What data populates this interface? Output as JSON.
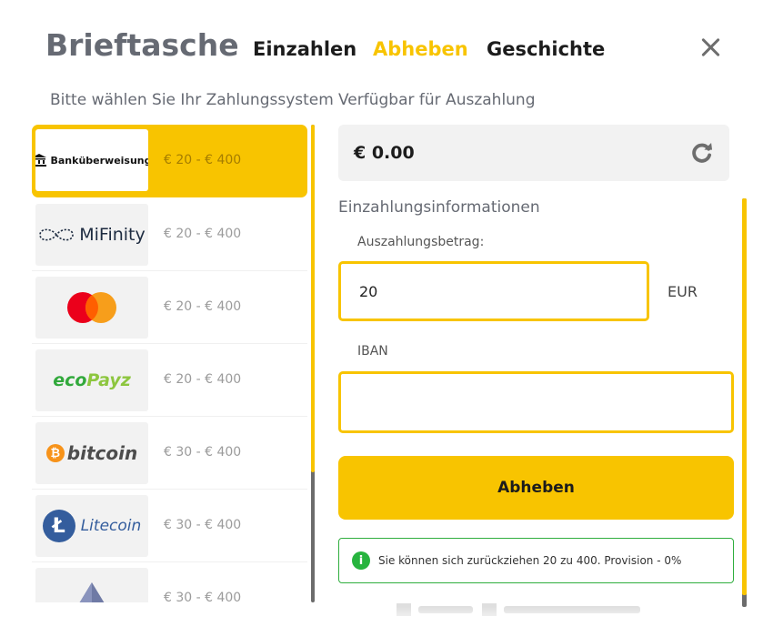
{
  "header": {
    "title": "Brieftasche",
    "tabs": [
      {
        "label": "Einzahlen",
        "active": false
      },
      {
        "label": "Abheben",
        "active": true
      },
      {
        "label": "Geschichte",
        "active": false
      }
    ]
  },
  "left": {
    "heading": "Bitte wählen Sie Ihr Zahlungssystem",
    "methods": [
      {
        "name": "Banküberweisung",
        "logo_text": "Banküberweisung",
        "range": "€ 20 - € 400",
        "selected": true
      },
      {
        "name": "MiFinity",
        "logo_text": "MiFinity",
        "range": "€ 20 - € 400"
      },
      {
        "name": "Mastercard",
        "logo_text": "",
        "range": "€ 20 - € 400"
      },
      {
        "name": "ecoPayz",
        "logo_text": "ecoPayz",
        "range": "€ 20 - € 400"
      },
      {
        "name": "bitcoin",
        "logo_text": "bitcoin",
        "range": "€ 30 - € 400"
      },
      {
        "name": "Litecoin",
        "logo_text": "Litecoin",
        "range": "€ 30 - € 400"
      },
      {
        "name": "Ethereum",
        "logo_text": "",
        "range": "€ 30 - € 400"
      }
    ]
  },
  "right": {
    "available_label": "Verfügbar für Auszahlung",
    "balance": "€ 0.00",
    "info_heading": "Einzahlungsinformationen",
    "amount_label": "Auszahlungsbetrag:",
    "amount_value": "20",
    "currency": "EUR",
    "iban_label": "IBAN",
    "iban_value": "",
    "submit_label": "Abheben",
    "notice": "Sie können sich zurückziehen 20 zu 400. Provision - 0%"
  },
  "colors": {
    "accent": "#f8c400",
    "success": "#2fae3e",
    "muted_text": "#666a73"
  },
  "icons": {
    "close": "close-icon",
    "refresh": "refresh-icon",
    "info": "info-icon",
    "bank": "bank-icon"
  }
}
